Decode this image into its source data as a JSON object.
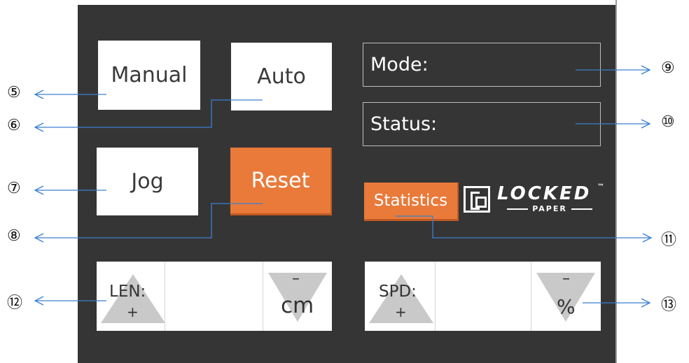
{
  "buttons": {
    "manual": "Manual",
    "auto": "Auto",
    "jog": "Jog",
    "reset": "Reset",
    "statistics": "Statistics"
  },
  "fields": {
    "mode": "Mode:",
    "status": "Status:"
  },
  "logo": {
    "word": "LOCKED",
    "tm": "™",
    "sub": "PAPER"
  },
  "len_adjust": {
    "label": "LEN:",
    "plus": "+",
    "minus": "–",
    "unit": "cm"
  },
  "spd_adjust": {
    "label": "SPD:",
    "plus": "+",
    "minus": "–",
    "unit": "%"
  },
  "callouts": {
    "c5": "⑤",
    "c6": "⑥",
    "c7": "⑦",
    "c8": "⑧",
    "c9": "⑨",
    "c10": "⑩",
    "c11": "⑪",
    "c12": "⑫",
    "c13": "⑬"
  },
  "colors": {
    "panel": "#353535",
    "accent_orange": "#e97a3a",
    "callout_line": "#3a7fd0"
  }
}
